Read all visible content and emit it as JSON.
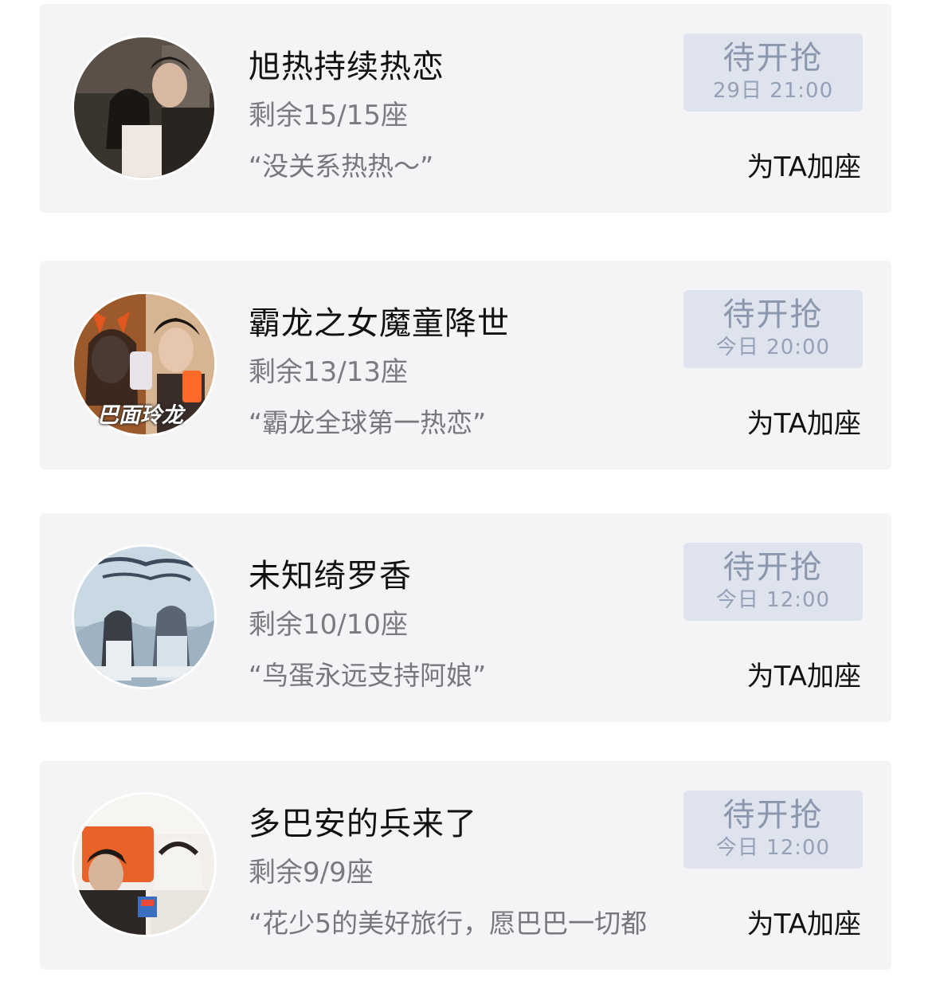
{
  "items": [
    {
      "title": "旭热持续热恋",
      "seats": "剩余15/15座",
      "quote": "“没关系热热～”",
      "status_label": "待开抢",
      "status_time": "29日 21:00",
      "action_label": "为TA加座",
      "avatar_icon": "couple-photo-avatar"
    },
    {
      "title": "霸龙之女魔童降世",
      "seats": "剩余13/13座",
      "quote": "“霸龙全球第一热恋”",
      "status_label": "待开抢",
      "status_time": "今日 20:00",
      "action_label": "为TA加座",
      "avatar_icon": "devil-horns-selfie-avatar",
      "avatar_text": "巴面玲龙"
    },
    {
      "title": "未知绮罗香",
      "seats": "剩余10/10座",
      "quote": "“鸟蛋永远支持阿娘”",
      "status_label": "待开抢",
      "status_time": "今日 12:00",
      "action_label": "为TA加座",
      "avatar_icon": "drama-poster-avatar"
    },
    {
      "title": "多巴安的兵来了",
      "seats": "剩余9/9座",
      "quote": "“花少5的美好旅行，愿巴巴一切都",
      "status_label": "待开抢",
      "status_time": "今日 12:00",
      "action_label": "为TA加座",
      "avatar_icon": "variety-show-avatar"
    }
  ],
  "colors": {
    "card_bg": "#f4f4f6",
    "status_bg": "#dee3ee",
    "status_text": "#8b97ad",
    "secondary_text": "#7a7a7f",
    "primary_text": "#111111"
  }
}
